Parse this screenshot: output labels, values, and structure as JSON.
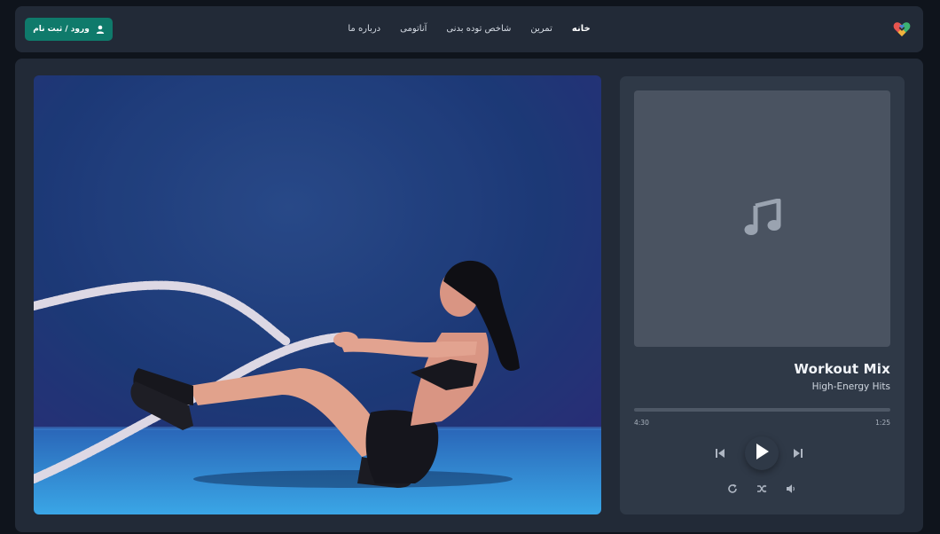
{
  "header": {
    "login_label": "ورود / ثبت نام",
    "nav": [
      {
        "label": "خانه",
        "active": true
      },
      {
        "label": "تمرین",
        "active": false
      },
      {
        "label": "شاخص توده بدنی",
        "active": false
      },
      {
        "label": "آناتومی",
        "active": false
      },
      {
        "label": "درباره ما",
        "active": false
      }
    ],
    "logo_icon": "heart-logo-icon",
    "accent_color": "#0f7a6b"
  },
  "hero": {
    "image": "woman-battle-ropes-photo"
  },
  "player": {
    "cover_icon": "music-note-icon",
    "title": "Workout Mix",
    "subtitle": "High-Energy Hits",
    "progress_fraction": 0,
    "current_time": "4:30",
    "duration": "1:25",
    "controls": [
      "previous-icon",
      "play-icon",
      "next-icon"
    ],
    "secondary_controls": [
      "repeat-icon",
      "shuffle-icon",
      "volume-icon"
    ]
  }
}
